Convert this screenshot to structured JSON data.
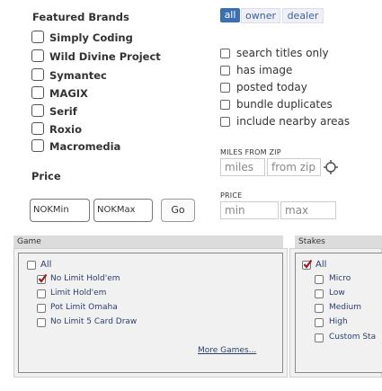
{
  "brands": {
    "title": "Featured Brands",
    "items": [
      {
        "label": "Simply Coding"
      },
      {
        "label": "Wild Divine Project"
      },
      {
        "label": "Symantec"
      },
      {
        "label": "MAGIX"
      },
      {
        "label": "Serif"
      },
      {
        "label": "Roxio"
      },
      {
        "label": "Macromedia"
      }
    ]
  },
  "price_left": {
    "title": "Price",
    "min_placeholder": "NOKMin",
    "max_placeholder": "NOKMax",
    "go_label": "Go"
  },
  "search": {
    "tabs": [
      "all",
      "owner",
      "dealer"
    ],
    "options": [
      {
        "label": "search titles only"
      },
      {
        "label": "has image"
      },
      {
        "label": "posted today"
      },
      {
        "label": "bundle duplicates"
      },
      {
        "label": "include nearby areas"
      }
    ],
    "miles_label": "MILES FROM ZIP",
    "miles_placeholder": "miles",
    "zip_placeholder": "from zip",
    "price_label": "PRICE",
    "min_placeholder": "min",
    "max_placeholder": "max"
  },
  "game": {
    "header": "Game",
    "items": [
      {
        "label": "All",
        "checked": false
      },
      {
        "label": "No Limit Hold'em",
        "checked": true
      },
      {
        "label": "Limit Hold'em",
        "checked": false
      },
      {
        "label": "Pot Limit Omaha",
        "checked": false
      },
      {
        "label": "No Limit 5 Card Draw",
        "checked": false
      }
    ],
    "more_label": "More Games..."
  },
  "stakes": {
    "header": "Stakes",
    "items": [
      {
        "label": "All",
        "checked": true
      },
      {
        "label": "Micro",
        "checked": false
      },
      {
        "label": "Low",
        "checked": false
      },
      {
        "label": "Medium",
        "checked": false
      },
      {
        "label": "High",
        "checked": false
      },
      {
        "label": "Custom Sta",
        "checked": false
      }
    ]
  },
  "colors": {
    "accent": "#3b6fb4",
    "check": "#a01818"
  }
}
